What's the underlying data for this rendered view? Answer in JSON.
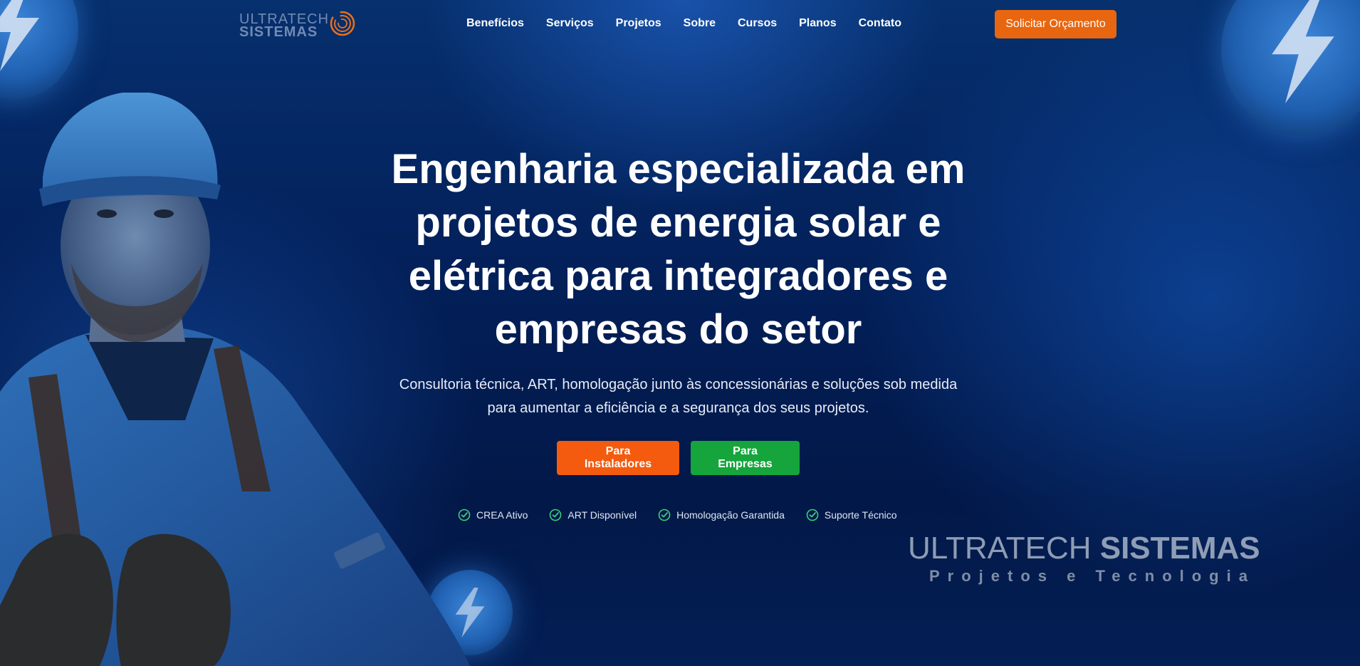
{
  "logo": {
    "line1": "ULTRATECH",
    "line2": "SISTEMAS",
    "mark_icon": "spiral-logo-icon"
  },
  "nav": {
    "links": [
      "Benefícios",
      "Serviços",
      "Projetos",
      "Sobre",
      "Cursos",
      "Planos",
      "Contato"
    ],
    "cta_label": "Solicitar Orçamento"
  },
  "hero": {
    "headline": "Engenharia especializada em projetos de energia solar e elétrica para integradores e empresas do setor",
    "subtitle": "Consultoria técnica, ART, homologação junto às concessionárias e soluções sob medida para aumentar a eficiência e a segurança dos seus projetos.",
    "buttons": {
      "installers": "Para Instaladores",
      "companies": "Para Empresas"
    },
    "badges": [
      "CREA Ativo",
      "ART Disponível",
      "Homologação Garantida",
      "Suporte Técnico"
    ],
    "badge_icon": "check-circle-icon"
  },
  "watermark": {
    "title_light": "ULTRATECH ",
    "title_bold": "SISTEMAS",
    "subtitle": "Projetos e Tecnologia"
  },
  "colors": {
    "cta_orange": "#e8660f",
    "installers_orange": "#f45b0f",
    "companies_green": "#15a53c",
    "badge_check_green": "#3ccf7a",
    "background_navy": "#031a4d"
  }
}
